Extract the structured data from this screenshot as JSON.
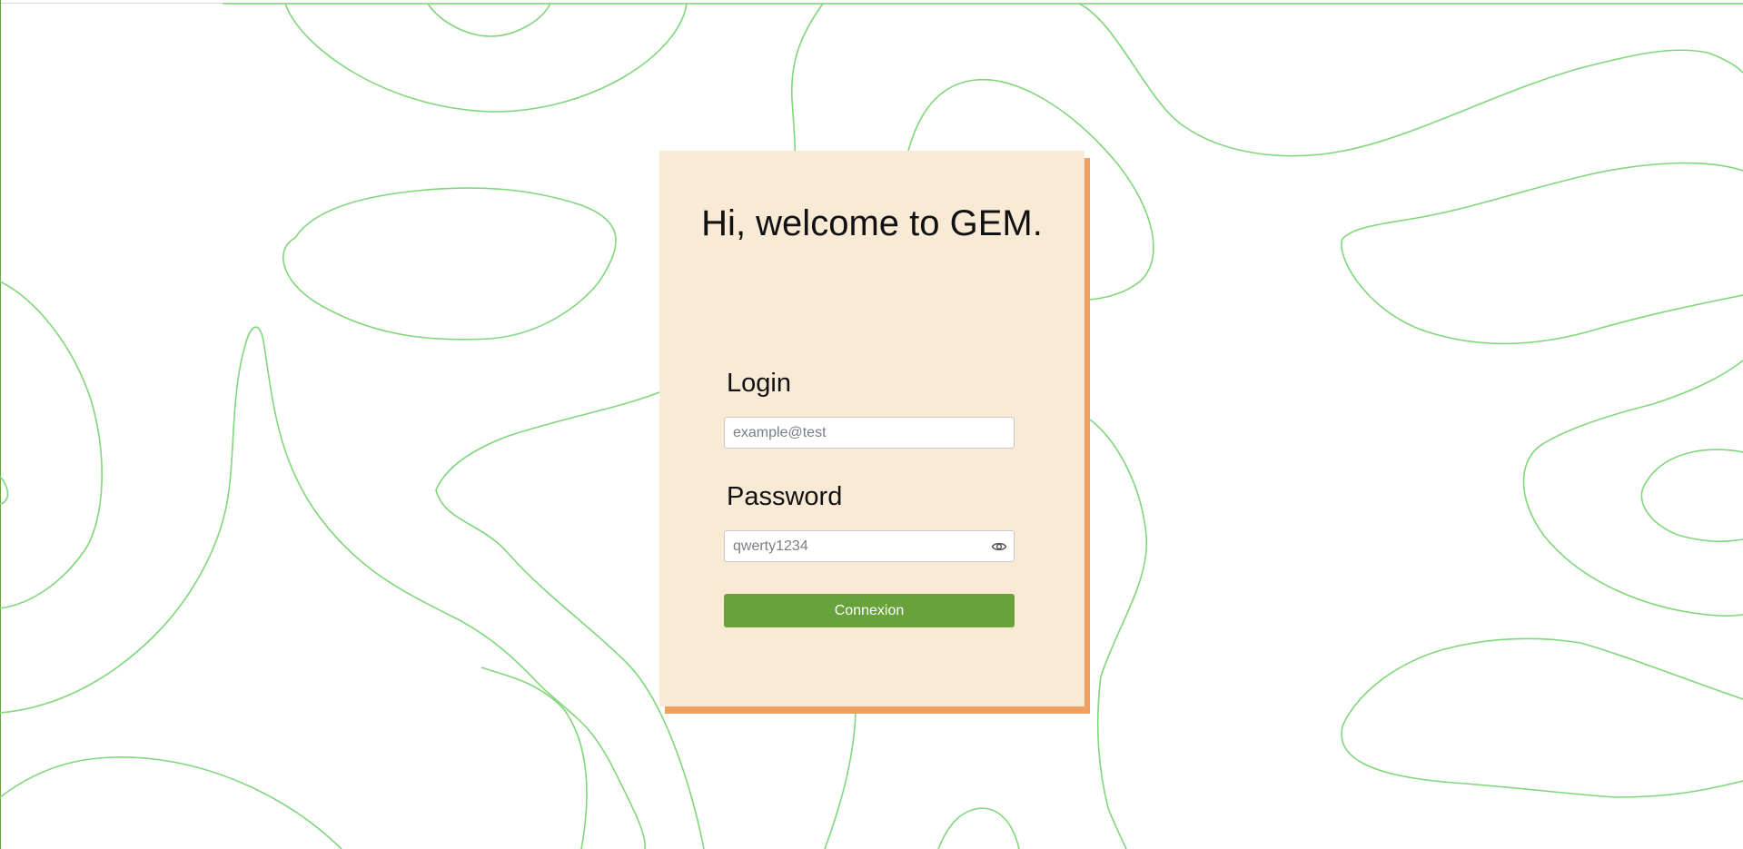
{
  "welcome": {
    "title": "Hi, welcome to GEM."
  },
  "login_form": {
    "login_label": "Login",
    "login_placeholder": "example@test",
    "password_label": "Password",
    "password_placeholder": "qwerty1234",
    "password_toggle_icon": "eye-icon",
    "submit_label": "Connexion"
  },
  "colors": {
    "card_background": "#f9ead6",
    "card_shadow": "#f0a060",
    "button": "#67a23a",
    "background_lines": "#7fd77a"
  }
}
